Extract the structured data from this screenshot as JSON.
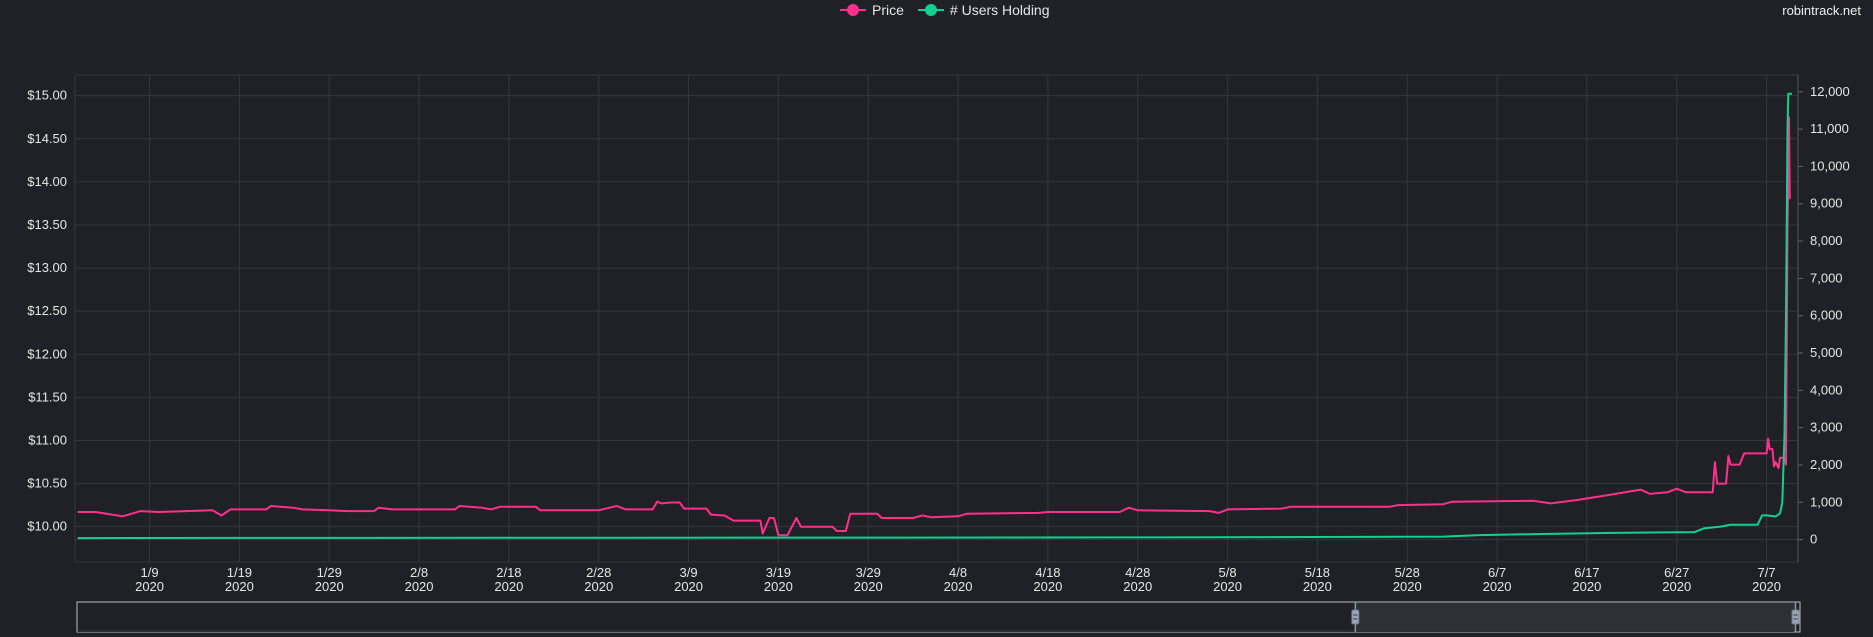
{
  "brand": "robintrack.net",
  "colors": {
    "price": "#ff2f8c",
    "users": "#14d08f",
    "grid": "#35373c",
    "background": "#1f2126"
  },
  "chart_data": {
    "type": "line",
    "title": "",
    "legend": {
      "placement": "top-center",
      "entries": [
        "Price",
        "# Users Holding"
      ]
    },
    "x_range": [
      "1/1",
      "7/10"
    ],
    "x_ticks": [
      [
        "1/9",
        "2020"
      ],
      [
        "1/19",
        "2020"
      ],
      [
        "1/29",
        "2020"
      ],
      [
        "2/8",
        "2020"
      ],
      [
        "2/18",
        "2020"
      ],
      [
        "2/28",
        "2020"
      ],
      [
        "3/9",
        "2020"
      ],
      [
        "3/19",
        "2020"
      ],
      [
        "3/29",
        "2020"
      ],
      [
        "4/8",
        "2020"
      ],
      [
        "4/18",
        "2020"
      ],
      [
        "4/28",
        "2020"
      ],
      [
        "5/8",
        "2020"
      ],
      [
        "5/18",
        "2020"
      ],
      [
        "5/28",
        "2020"
      ],
      [
        "6/7",
        "2020"
      ],
      [
        "6/17",
        "2020"
      ],
      [
        "6/27",
        "2020"
      ],
      [
        "7/7",
        "2020"
      ]
    ],
    "y_left": {
      "label": "Price",
      "ticks": [
        "$10.00",
        "$10.50",
        "$11.00",
        "$11.50",
        "$12.00",
        "$12.50",
        "$13.00",
        "$13.50",
        "$14.00",
        "$14.50",
        "$15.00"
      ],
      "range": [
        9.59,
        15.24
      ]
    },
    "y_right": {
      "label": "# Users Holding",
      "ticks": [
        "0",
        "1,000",
        "2,000",
        "3,000",
        "4,000",
        "5,000",
        "6,000",
        "7,000",
        "8,000",
        "9,000",
        "10,000",
        "11,000",
        "12,000"
      ],
      "range": [
        -600,
        12450
      ]
    },
    "grid": true,
    "series": [
      {
        "name": "Price",
        "axis": "left",
        "points": [
          [
            "1/1",
            10.17
          ],
          [
            "1/3",
            10.17
          ],
          [
            "1/6",
            10.12
          ],
          [
            "1/8",
            10.18
          ],
          [
            "1/10",
            10.17
          ],
          [
            "1/16",
            10.19
          ],
          [
            "1/17",
            10.13
          ],
          [
            "1/18",
            10.2
          ],
          [
            "1/22",
            10.2
          ],
          [
            "1/22 12",
            10.24
          ],
          [
            "1/25",
            10.22
          ],
          [
            "1/26",
            10.2
          ],
          [
            "1/29",
            10.19
          ],
          [
            "1/31",
            10.18
          ],
          [
            "2/3",
            10.18
          ],
          [
            "2/3 12",
            10.22
          ],
          [
            "2/5",
            10.2
          ],
          [
            "2/12",
            10.2
          ],
          [
            "2/12 12",
            10.24
          ],
          [
            "2/15",
            10.22
          ],
          [
            "2/16",
            10.2
          ],
          [
            "2/17",
            10.23
          ],
          [
            "2/21",
            10.23
          ],
          [
            "2/21 12",
            10.19
          ],
          [
            "2/28",
            10.19
          ],
          [
            "3/1",
            10.24
          ],
          [
            "3/2",
            10.2
          ],
          [
            "3/5",
            10.2
          ],
          [
            "3/5 12",
            10.29
          ],
          [
            "3/6",
            10.27
          ],
          [
            "3/7",
            10.28
          ],
          [
            "3/8",
            10.28
          ],
          [
            "3/8 12",
            10.21
          ],
          [
            "3/11",
            10.21
          ],
          [
            "3/11 12",
            10.14
          ],
          [
            "3/13",
            10.13
          ],
          [
            "3/14",
            10.07
          ],
          [
            "3/17",
            10.07
          ],
          [
            "3/17 6",
            9.92
          ],
          [
            "3/18",
            10.1
          ],
          [
            "3/18 12",
            10.1
          ],
          [
            "3/19",
            9.9
          ],
          [
            "3/20",
            9.9
          ],
          [
            "3/21",
            10.1
          ],
          [
            "3/21 12",
            10.0
          ],
          [
            "3/25",
            10.0
          ],
          [
            "3/25 12",
            9.95
          ],
          [
            "3/26 12",
            9.95
          ],
          [
            "3/27",
            10.15
          ],
          [
            "3/30",
            10.15
          ],
          [
            "3/30 12",
            10.1
          ],
          [
            "4/3",
            10.1
          ],
          [
            "4/4",
            10.13
          ],
          [
            "4/5",
            10.11
          ],
          [
            "4/8",
            10.12
          ],
          [
            "4/9",
            10.15
          ],
          [
            "4/17",
            10.16
          ],
          [
            "4/18",
            10.17
          ],
          [
            "4/26",
            10.17
          ],
          [
            "4/27",
            10.22
          ],
          [
            "4/28",
            10.19
          ],
          [
            "5/6",
            10.18
          ],
          [
            "5/7",
            10.16
          ],
          [
            "5/8",
            10.2
          ],
          [
            "5/14",
            10.21
          ],
          [
            "5/15",
            10.23
          ],
          [
            "5/26",
            10.23
          ],
          [
            "5/27",
            10.25
          ],
          [
            "6/1",
            10.26
          ],
          [
            "6/2",
            10.29
          ],
          [
            "6/11",
            10.3
          ],
          [
            "6/13",
            10.27
          ],
          [
            "6/16",
            10.31
          ],
          [
            "6/19",
            10.36
          ],
          [
            "6/23",
            10.43
          ],
          [
            "6/24",
            10.38
          ],
          [
            "6/26",
            10.4
          ],
          [
            "6/27",
            10.44
          ],
          [
            "6/28",
            10.4
          ],
          [
            "7/1",
            10.4
          ],
          [
            "7/1 6",
            10.75
          ],
          [
            "7/1 12",
            10.5
          ],
          [
            "7/2 12",
            10.5
          ],
          [
            "7/2 18",
            10.82
          ],
          [
            "7/3",
            10.72
          ],
          [
            "7/4",
            10.72
          ],
          [
            "7/4 12",
            10.85
          ],
          [
            "7/7",
            10.85
          ],
          [
            "7/7 4",
            11.02
          ],
          [
            "7/7 8",
            10.9
          ],
          [
            "7/7 16",
            10.9
          ],
          [
            "7/7 20",
            10.7
          ],
          [
            "7/8",
            10.75
          ],
          [
            "7/8 8",
            10.68
          ],
          [
            "7/8 12",
            10.8
          ],
          [
            "7/9",
            10.8
          ],
          [
            "7/9 4",
            10.72
          ],
          [
            "7/9 8",
            13.5
          ],
          [
            "7/9 10",
            14.0
          ],
          [
            "7/9 12",
            14.75
          ],
          [
            "7/9 14",
            13.8
          ]
        ]
      },
      {
        "name": "# Users Holding",
        "axis": "right",
        "points": [
          [
            "1/1",
            40
          ],
          [
            "1/22",
            45
          ],
          [
            "3/1",
            50
          ],
          [
            "4/1",
            55
          ],
          [
            "5/1",
            60
          ],
          [
            "6/1",
            80
          ],
          [
            "6/5",
            120
          ],
          [
            "6/12",
            150
          ],
          [
            "6/20",
            180
          ],
          [
            "6/29",
            200
          ],
          [
            "6/30",
            300
          ],
          [
            "7/2",
            350
          ],
          [
            "7/3",
            400
          ],
          [
            "7/6",
            400
          ],
          [
            "7/6 12",
            650
          ],
          [
            "7/7",
            650
          ],
          [
            "7/8",
            620
          ],
          [
            "7/8 12",
            700
          ],
          [
            "7/8 18",
            1000
          ],
          [
            "7/9",
            2800
          ],
          [
            "7/9 4",
            6000
          ],
          [
            "7/9 8",
            11000
          ],
          [
            "7/9 10",
            11950
          ],
          [
            "7/9 20",
            11950
          ]
        ]
      }
    ],
    "range_selector": {
      "start": "5/22",
      "end": "7/10"
    }
  }
}
